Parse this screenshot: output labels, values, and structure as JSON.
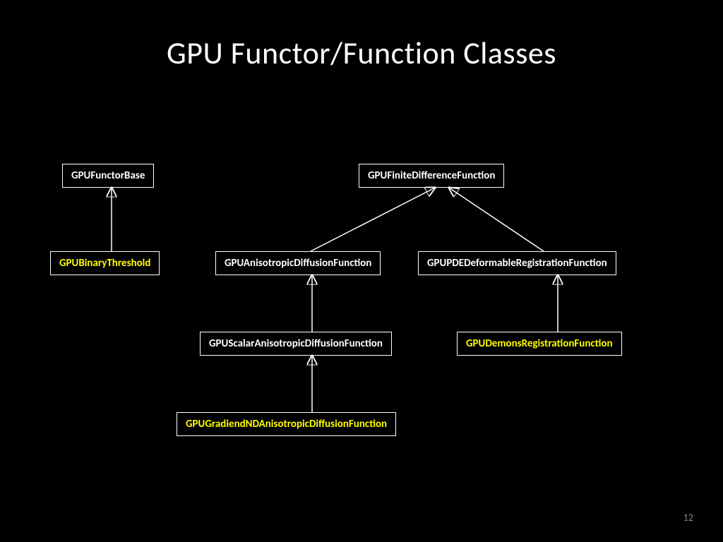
{
  "title": "GPU Functor/Function Classes",
  "page_number": "12",
  "nodes": {
    "functor_base": {
      "label": "GPUFunctorBase",
      "color": "white"
    },
    "binary_threshold": {
      "label": "GPUBinaryThreshold",
      "color": "yellow"
    },
    "finite_diff": {
      "label": "GPUFiniteDifferenceFunction",
      "color": "white"
    },
    "aniso_diff": {
      "label": "GPUAnisotropicDiffusionFunction",
      "color": "white"
    },
    "pde_deform": {
      "label": "GPUPDEDeformableRegistrationFunction",
      "color": "white"
    },
    "scalar_aniso": {
      "label": "GPUScalarAnisotropicDiffusionFunction",
      "color": "white"
    },
    "demons_reg": {
      "label": "GPUDemonsRegistrationFunction",
      "color": "yellow"
    },
    "gradient_nd": {
      "label": "GPUGradiendNDAnisotropicDiffusionFunction",
      "color": "yellow"
    }
  },
  "edges": [
    {
      "from": "binary_threshold",
      "to": "functor_base"
    },
    {
      "from": "aniso_diff",
      "to": "finite_diff"
    },
    {
      "from": "pde_deform",
      "to": "finite_diff"
    },
    {
      "from": "scalar_aniso",
      "to": "aniso_diff"
    },
    {
      "from": "demons_reg",
      "to": "pde_deform"
    },
    {
      "from": "gradient_nd",
      "to": "scalar_aniso"
    }
  ]
}
